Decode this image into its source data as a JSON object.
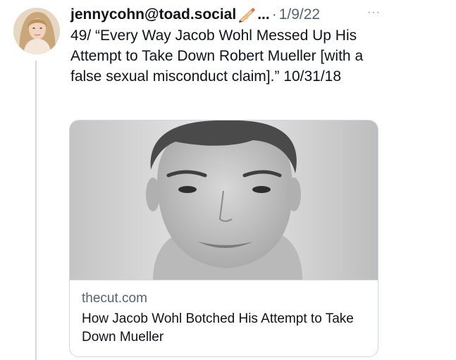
{
  "tweet": {
    "username": "jennycohn@toad.social",
    "username_suffix": "...",
    "separator": "·",
    "date": "1/9/22",
    "more_label": "···",
    "text": "49/ “Every Way Jacob Wohl Messed Up His Attempt to Take Down Robert Mueller [with a false sexual misconduct claim].” 10/31/18"
  },
  "card": {
    "domain": "thecut.com",
    "title": "How Jacob Wohl Botched His Attempt to Take Down Mueller"
  },
  "icons": {
    "avatar": "profile-photo",
    "pen": "writing-hand-icon",
    "more": "more-options-icon",
    "thumbnail": "article-photo"
  },
  "colors": {
    "text": "#0f1419",
    "muted": "#536471",
    "border": "#cfd9de",
    "thread_line": "#cfd9de"
  }
}
